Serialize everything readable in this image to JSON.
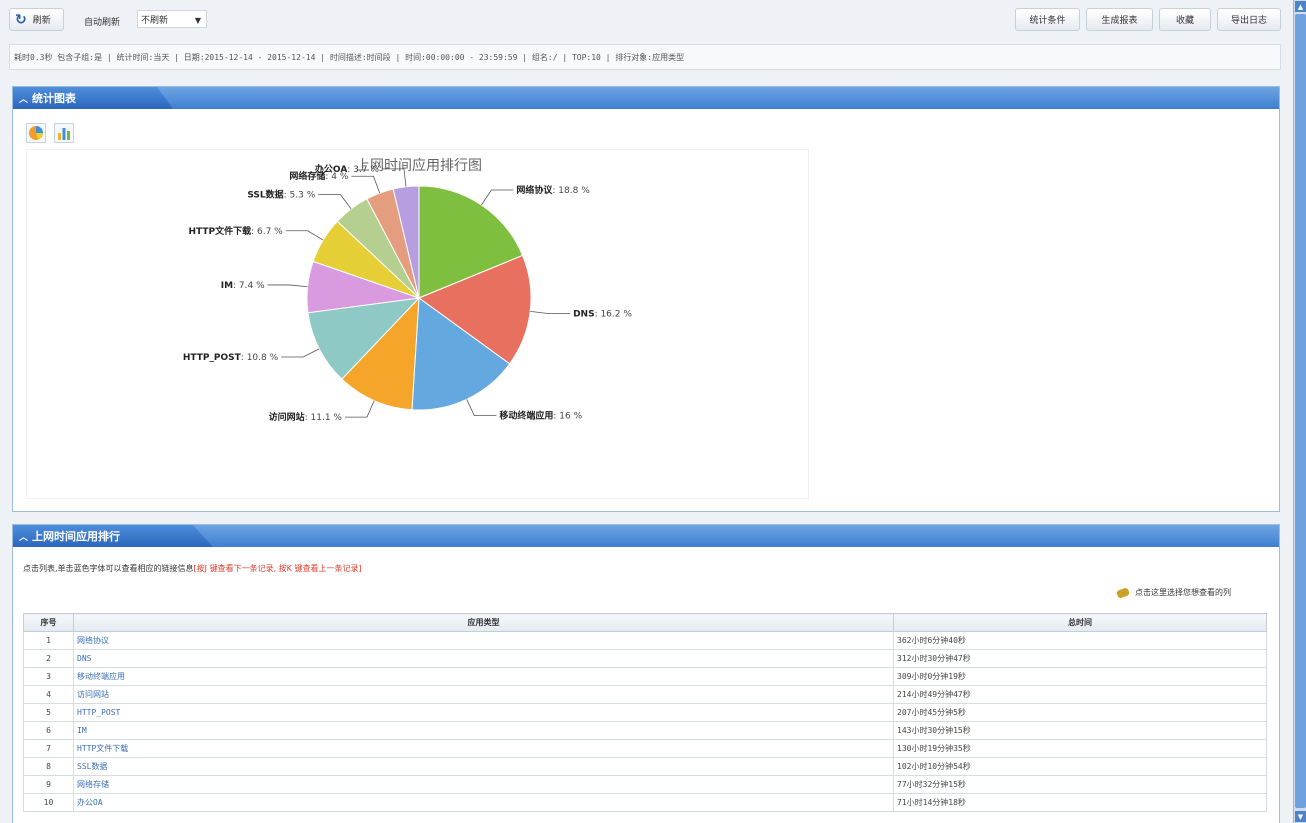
{
  "toolbar": {
    "refresh_label": "刷新",
    "auto_refresh_label": "自动刷新",
    "auto_refresh_value": "不刷新",
    "buttons": [
      "统计条件",
      "生成报表",
      "收藏",
      "导出日志"
    ]
  },
  "info": "耗时0.3秒 包含子组:是 | 统计时间:当天 | 日期:2015-12-14 - 2015-12-14 | 时间描述:时间段 | 时间:00:00:00 - 23:59:59 | 组名:/ | TOP:10 | 排行对象:应用类型",
  "chart_panel": {
    "title": "统计图表"
  },
  "chart_data": {
    "type": "pie",
    "title": "上网时间应用排行图",
    "unit": "%",
    "slices": [
      {
        "label": "网络协议",
        "value": 18.8,
        "color": "#7fbf3f"
      },
      {
        "label": "DNS",
        "value": 16.2,
        "color": "#e8705f"
      },
      {
        "label": "移动终端应用",
        "value": 16,
        "color": "#64a8e0"
      },
      {
        "label": "访问网站",
        "value": 11.1,
        "color": "#f6a52b"
      },
      {
        "label": "HTTP_POST",
        "value": 10.8,
        "color": "#8ec9c6"
      },
      {
        "label": "IM",
        "value": 7.4,
        "color": "#d99ae0"
      },
      {
        "label": "HTTP文件下载",
        "value": 6.7,
        "color": "#e6cf36"
      },
      {
        "label": "SSL数据",
        "value": 5.3,
        "color": "#b5cf90"
      },
      {
        "label": "网络存储",
        "value": 4,
        "color": "#e49e7f"
      },
      {
        "label": "办公OA",
        "value": 3.7,
        "color": "#b79ee0"
      }
    ]
  },
  "rank_panel": {
    "title": "上网时间应用排行",
    "hint_text": "点击列表,单击蓝色字体可以查看相应的链接信息",
    "hint_red": "[按J 键查看下一条记录, 按K 键查看上一条记录]",
    "column_chooser": "点击这里选择您想查看的列",
    "columns": [
      "序号",
      "应用类型",
      "总时间"
    ],
    "rows": [
      {
        "idx": "1",
        "app": "网络协议",
        "time": "362小时6分钟40秒"
      },
      {
        "idx": "2",
        "app": "DNS",
        "time": "312小时30分钟47秒"
      },
      {
        "idx": "3",
        "app": "移动终端应用",
        "time": "309小时0分钟19秒"
      },
      {
        "idx": "4",
        "app": "访问网站",
        "time": "214小时49分钟47秒"
      },
      {
        "idx": "5",
        "app": "HTTP_POST",
        "time": "207小时45分钟5秒"
      },
      {
        "idx": "6",
        "app": "IM",
        "time": "143小时30分钟15秒"
      },
      {
        "idx": "7",
        "app": "HTTP文件下载",
        "time": "130小时19分钟35秒"
      },
      {
        "idx": "8",
        "app": "SSL数据",
        "time": "102小时10分钟54秒"
      },
      {
        "idx": "9",
        "app": "网络存储",
        "time": "77小时32分钟15秒"
      },
      {
        "idx": "10",
        "app": "办公OA",
        "time": "71小时14分钟18秒"
      }
    ]
  },
  "colors": {
    "header_blue": "#3f7fd1",
    "link": "#3b6fb3",
    "hint_red": "#e23b2a"
  }
}
